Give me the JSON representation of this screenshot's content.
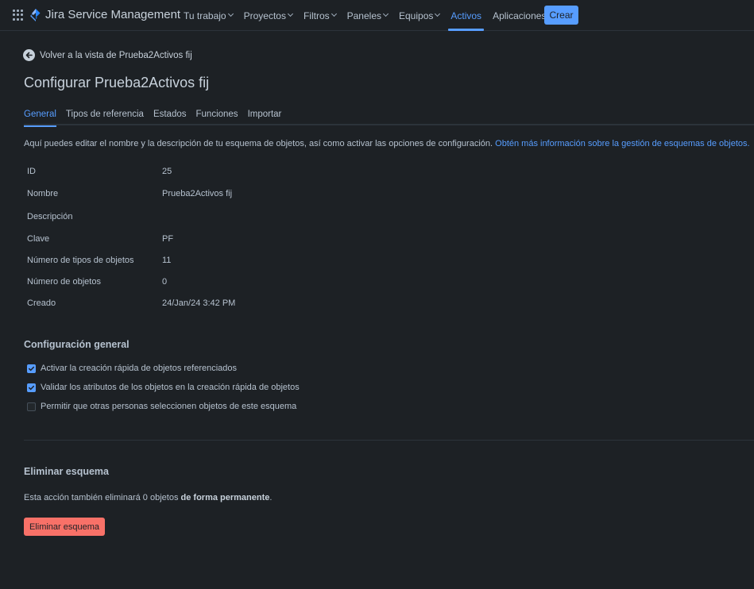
{
  "nav": {
    "brand": "Jira Service Management",
    "items": [
      {
        "label": "Tu trabajo",
        "dropdown": true,
        "active": false
      },
      {
        "label": "Proyectos",
        "dropdown": true,
        "active": false
      },
      {
        "label": "Filtros",
        "dropdown": true,
        "active": false
      },
      {
        "label": "Paneles",
        "dropdown": true,
        "active": false
      },
      {
        "label": "Equipos",
        "dropdown": true,
        "active": false
      },
      {
        "label": "Activos",
        "dropdown": false,
        "active": true
      },
      {
        "label": "Aplicaciones",
        "dropdown": true,
        "active": false
      }
    ],
    "create_label": "Crear"
  },
  "back_link": "Volver a la vista de Prueba2Activos fij",
  "page_title": "Configurar Prueba2Activos fij",
  "tabs": [
    {
      "label": "General",
      "active": true
    },
    {
      "label": "Tipos de referencia",
      "active": false
    },
    {
      "label": "Estados",
      "active": false
    },
    {
      "label": "Funciones",
      "active": false
    },
    {
      "label": "Importar",
      "active": false
    }
  ],
  "intro": {
    "text": "Aquí puedes editar el nombre y la descripción de tu esquema de objetos, así como activar las opciones de configuración.",
    "link": "Obtén más información sobre la gestión de esquemas de objetos."
  },
  "details": [
    {
      "label": "ID",
      "value": "25"
    },
    {
      "label": "Nombre",
      "value": "Prueba2Activos fij"
    },
    {
      "label": "Descripción",
      "value": ""
    },
    {
      "label": "Clave",
      "value": "PF"
    },
    {
      "label": "Número de tipos de objetos",
      "value": "11"
    },
    {
      "label": "Número de objetos",
      "value": "0"
    },
    {
      "label": "Creado",
      "value": "24/Jan/24 3:42 PM"
    }
  ],
  "general_config": {
    "title": "Configuración general",
    "options": [
      {
        "label": "Activar la creación rápida de objetos referenciados",
        "checked": true
      },
      {
        "label": "Validar los atributos de los objetos en la creación rápida de objetos",
        "checked": true
      },
      {
        "label": "Permitir que otras personas seleccionen objetos de este esquema",
        "checked": false
      }
    ]
  },
  "delete_section": {
    "title": "Eliminar esquema",
    "text": "Esta acción también eliminará 0 objetos",
    "text_bold": "de forma permanente",
    "text_end": ".",
    "button_label": "Eliminar esquema"
  },
  "colors": {
    "background": "#1d2125",
    "accent": "#579dff",
    "danger": "#f87168"
  },
  "icons": {
    "app_switcher": "grid-icon",
    "brand": "jira-logo-icon",
    "back": "arrow-left-circle-icon",
    "check": "checkmark-icon",
    "dropdown": "chevron-down-icon"
  }
}
